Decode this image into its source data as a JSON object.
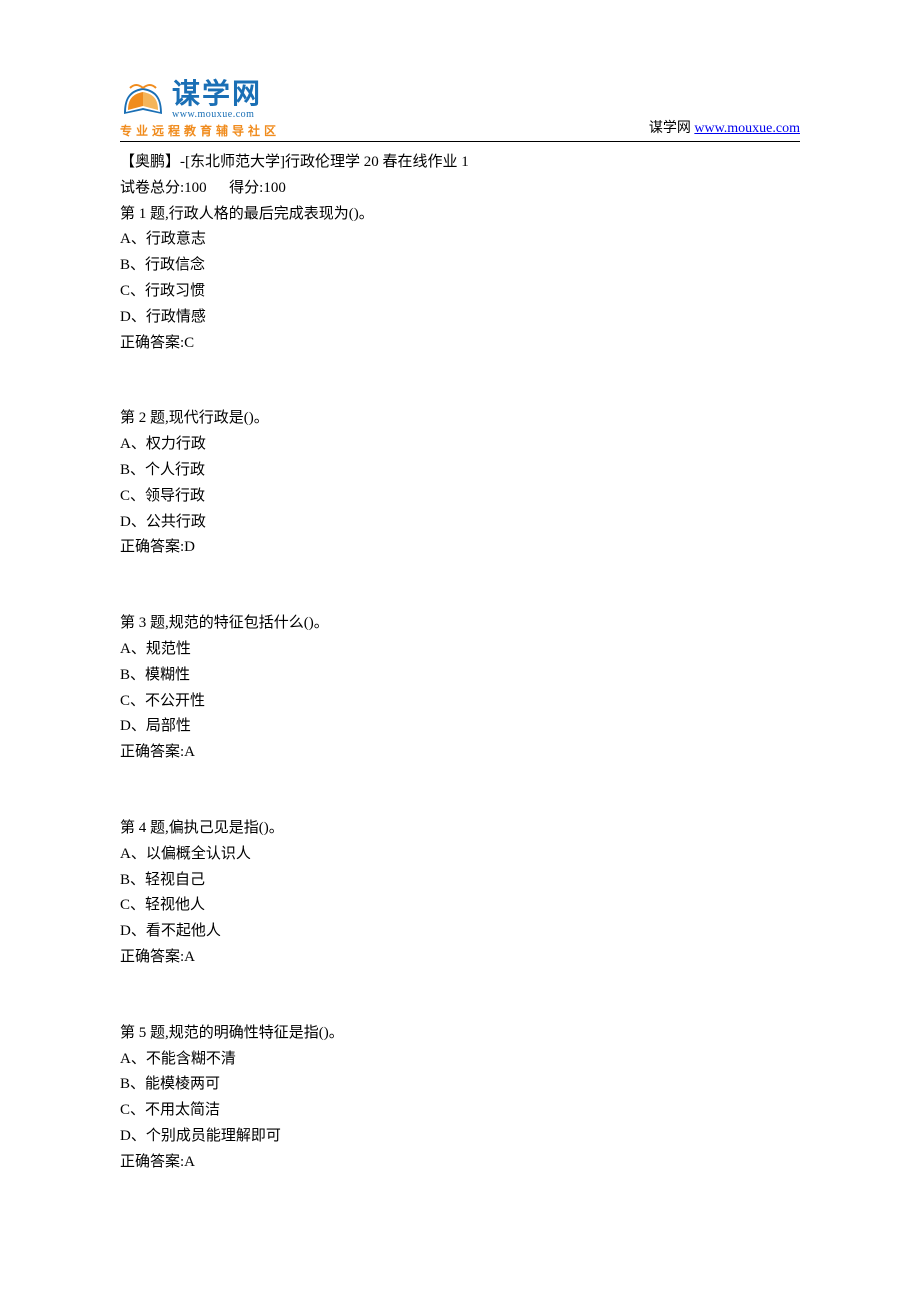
{
  "header": {
    "logo_title": "谋学网",
    "logo_sub": "www.mouxue.com",
    "logo_tagline": "专业远程教育辅导社区",
    "site_label": "谋学网 ",
    "site_link": "www.mouxue.com"
  },
  "doc": {
    "title": "【奥鹏】-[东北师范大学]行政伦理学 20 春在线作业 1",
    "score_line": "试卷总分:100      得分:100"
  },
  "questions": [
    {
      "prompt": "第 1 题,行政人格的最后完成表现为()。",
      "options": [
        "A、行政意志",
        "B、行政信念",
        "C、行政习惯",
        "D、行政情感"
      ],
      "answer": "正确答案:C"
    },
    {
      "prompt": "第 2 题,现代行政是()。",
      "options": [
        "A、权力行政",
        "B、个人行政",
        "C、领导行政",
        "D、公共行政"
      ],
      "answer": "正确答案:D"
    },
    {
      "prompt": "第 3 题,规范的特征包括什么()。",
      "options": [
        "A、规范性",
        "B、模糊性",
        "C、不公开性",
        "D、局部性"
      ],
      "answer": "正确答案:A"
    },
    {
      "prompt": "第 4 题,偏执己见是指()。",
      "options": [
        "A、以偏概全认识人",
        "B、轻视自己",
        "C、轻视他人",
        "D、看不起他人"
      ],
      "answer": "正确答案:A"
    },
    {
      "prompt": "第 5 题,规范的明确性特征是指()。",
      "options": [
        "A、不能含糊不清",
        "B、能模棱两可",
        "C、不用太简洁",
        "D、个别成员能理解即可"
      ],
      "answer": "正确答案:A"
    }
  ]
}
